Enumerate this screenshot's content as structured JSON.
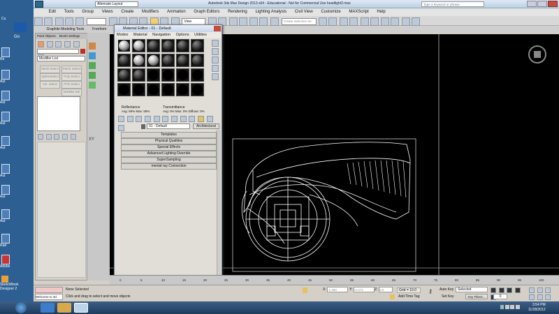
{
  "desktop": {
    "icons": [
      "Re",
      "Aut",
      "Aut",
      "Aut",
      "Aut",
      "Aut",
      "Aut",
      "Aut",
      "Sketchbook",
      "Rad",
      "Adobe"
    ],
    "top_labels": [
      "Cu",
      "Go"
    ],
    "sketchbook_label": "SketchBook Designer 2",
    "bottom_label": "Welcome to 3d"
  },
  "app": {
    "title": "Autodesk 3ds Max Design 2013 x64 - Educational - Not for Commercial Use     headlight2.max",
    "workspace": "Alternate Layout",
    "search_placeholder": "Type a keyword or phrase",
    "menus": [
      "Edit",
      "Tools",
      "Group",
      "Views",
      "Create",
      "Modifiers",
      "Animation",
      "Graph Editors",
      "Rendering",
      "Lighting Analysis",
      "Civil View",
      "Customize",
      "MAXScript",
      "Help"
    ],
    "view_dropdown": "View",
    "selection_set": "Create Selection Se"
  },
  "ribbon": {
    "tabs": [
      "Graphite Modeling Tools",
      "Freeform"
    ],
    "subtabs": [
      "Paint Objects",
      "Brush Settings"
    ]
  },
  "command_panel": {
    "modifier_list": "Modifier List",
    "buttons": [
      "Mesh Select",
      "Patch Select",
      "SplineSelect",
      "Poly Select",
      "Vol. Select",
      "FFD Select",
      "",
      "NURBS Sel"
    ]
  },
  "material_editor": {
    "title": "Material Editor - 01 - Default",
    "menus": [
      "Modes",
      "Material",
      "Navigation",
      "Options",
      "Utilities"
    ],
    "reflectance_label": "Reflectance",
    "reflectance_values": "Avg: 59% Max: 59%",
    "transmittance_label": "Transmittance",
    "transmittance_values": "Avg:  0% Max:  0%  Diffuse:  0%",
    "material_name": "01 - Default",
    "material_type": "Architectural",
    "rollouts": [
      "Templates",
      "Physical Qualities",
      "Special Effects",
      "Advanced Lighting Override",
      "SuperSampling",
      "mental ray Connection"
    ],
    "slots": [
      "white",
      "white",
      "grey",
      "grey",
      "grey",
      "grey",
      "grey",
      "white",
      "white",
      "grey",
      "grey",
      "grey",
      "grey",
      "grey",
      "black",
      "black",
      "black",
      "black",
      "black",
      "black",
      "black",
      "black",
      "black",
      "black"
    ]
  },
  "timeline": {
    "ticks": [
      "0",
      "5",
      "10",
      "15",
      "20",
      "25",
      "30",
      "35",
      "40",
      "45",
      "50",
      "55",
      "60",
      "65",
      "70",
      "75",
      "80",
      "85",
      "90",
      "95",
      "100"
    ]
  },
  "status": {
    "selection": "None Selected",
    "prompt": "Click and drag to select and move objects",
    "x_label": "X:",
    "x_value": "-1.490",
    "y_label": "Y:",
    "y_value": "-3.474",
    "z_label": "Z:",
    "z_value": "0.0",
    "grid": "Grid = 10.0",
    "add_time_tag": "Add Time Tag",
    "auto_key": "Auto Key",
    "auto_key_value": "Selected",
    "set_key": "Set Key",
    "key_filters": "Key Filters...",
    "frame": "0"
  },
  "taskbar": {
    "time": "3:54 PM",
    "date": "11/28/2012"
  },
  "colors": {
    "viewport_bg": "#000000",
    "wireframe": "#ffffff",
    "taskbar": "#1e3b5c"
  }
}
